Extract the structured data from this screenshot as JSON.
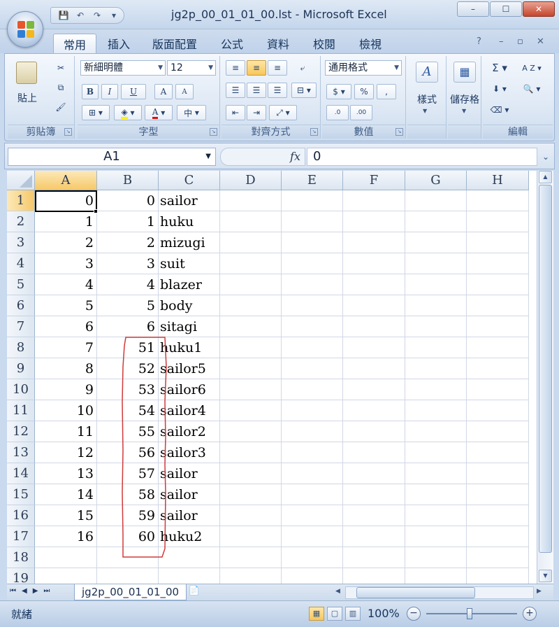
{
  "window": {
    "title": "jg2p_00_01_01_00.lst - Microsoft Excel",
    "minimize": "–",
    "maximize": "☐",
    "close": "✕"
  },
  "qat": {
    "save": "💾",
    "undo": "↶",
    "redo": "↷",
    "more": "▾"
  },
  "tabs": [
    {
      "label": "常用",
      "active": true
    },
    {
      "label": "插入"
    },
    {
      "label": "版面配置"
    },
    {
      "label": "公式"
    },
    {
      "label": "資料"
    },
    {
      "label": "校閱"
    },
    {
      "label": "檢視"
    }
  ],
  "ribbon_right": {
    "help": "?",
    "min": "–",
    "restore": "▫",
    "close": "✕"
  },
  "groups": {
    "clipboard": {
      "label": "剪貼簿",
      "paste": "貼上"
    },
    "font": {
      "label": "字型",
      "font_name": "新細明體",
      "font_size": "12",
      "bold": "B",
      "italic": "I",
      "underline": "U",
      "grow": "A",
      "shrink": "A",
      "color_a": "A",
      "phonetic": "中"
    },
    "alignment": {
      "label": "對齊方式"
    },
    "number": {
      "label": "數值",
      "format": "通用格式",
      "currency": "$",
      "percent": "%",
      "comma": ",",
      "inc": ".0",
      "dec": ".00"
    },
    "styles": {
      "label": "",
      "styles_btn": "樣式"
    },
    "cells": {
      "label": "",
      "cells_btn": "儲存格"
    },
    "editing": {
      "label": "編輯",
      "sum": "Σ",
      "sort": "A Z",
      "find": "🔍"
    }
  },
  "formula_bar": {
    "name_box": "A1",
    "fx": "fx",
    "value": "0"
  },
  "columns": [
    "A",
    "B",
    "C",
    "D",
    "E",
    "F",
    "G",
    "H"
  ],
  "selected_column": "A",
  "selected_row": 1,
  "rows": [
    {
      "n": "1",
      "a": "0",
      "b": "0",
      "c": "sailor"
    },
    {
      "n": "2",
      "a": "1",
      "b": "1",
      "c": "huku"
    },
    {
      "n": "3",
      "a": "2",
      "b": "2",
      "c": "mizugi"
    },
    {
      "n": "4",
      "a": "3",
      "b": "3",
      "c": "suit"
    },
    {
      "n": "5",
      "a": "4",
      "b": "4",
      "c": "blazer"
    },
    {
      "n": "6",
      "a": "5",
      "b": "5",
      "c": "body"
    },
    {
      "n": "7",
      "a": "6",
      "b": "6",
      "c": "sitagi"
    },
    {
      "n": "8",
      "a": "7",
      "b": "51",
      "c": "huku1"
    },
    {
      "n": "9",
      "a": "8",
      "b": "52",
      "c": "sailor5"
    },
    {
      "n": "10",
      "a": "9",
      "b": "53",
      "c": "sailor6"
    },
    {
      "n": "11",
      "a": "10",
      "b": "54",
      "c": "sailor4"
    },
    {
      "n": "12",
      "a": "11",
      "b": "55",
      "c": "sailor2"
    },
    {
      "n": "13",
      "a": "12",
      "b": "56",
      "c": "sailor3"
    },
    {
      "n": "14",
      "a": "13",
      "b": "57",
      "c": "sailor"
    },
    {
      "n": "15",
      "a": "14",
      "b": "58",
      "c": "sailor"
    },
    {
      "n": "16",
      "a": "15",
      "b": "59",
      "c": "sailor"
    },
    {
      "n": "17",
      "a": "16",
      "b": "60",
      "c": "huku2"
    },
    {
      "n": "18",
      "a": "",
      "b": "",
      "c": ""
    },
    {
      "n": "19",
      "a": "",
      "b": "",
      "c": ""
    }
  ],
  "sheet_tabs": {
    "nav": [
      "⏮",
      "◀",
      "▶",
      "⏭"
    ],
    "active_tab": "jg2p_00_01_01_00",
    "insert": "📄"
  },
  "status": {
    "ready": "就緒",
    "zoom": "100%",
    "minus": "−",
    "plus": "+"
  },
  "colors": {
    "annotation": "#d03a3a",
    "selection": "#f6c86a"
  }
}
